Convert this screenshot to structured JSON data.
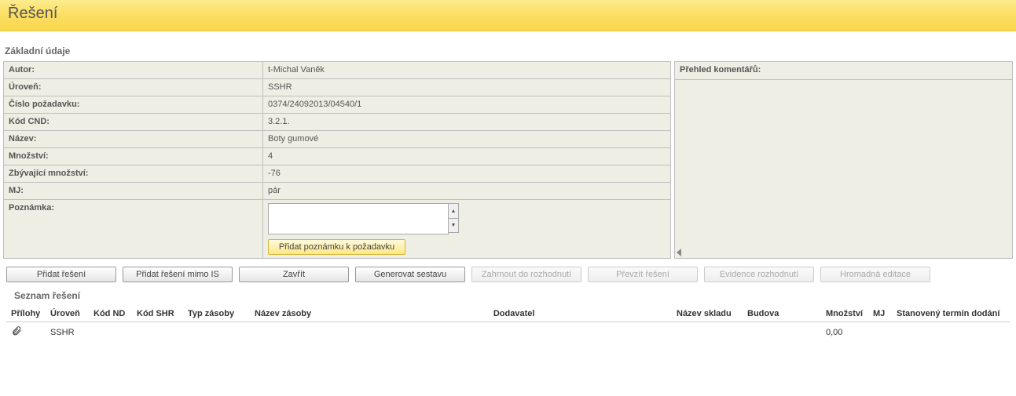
{
  "header": {
    "title": "Řešení"
  },
  "basic": {
    "section_title": "Základní údaje",
    "rows": {
      "author_label": "Autor:",
      "author_value": "t-Michal Vaněk",
      "level_label": "Úroveň:",
      "level_value": "SSHR",
      "reqnum_label": "Číslo požadavku:",
      "reqnum_value": "0374/24092013/04540/1",
      "cnd_label": "Kód CND:",
      "cnd_value": "3.2.1.",
      "name_label": "Název:",
      "name_value": "Boty gumové",
      "qty_label": "Množství:",
      "qty_value": "4",
      "remqty_label": "Zbývající množství:",
      "remqty_value": "-76",
      "mj_label": "MJ:",
      "mj_value": "pár",
      "note_label": "Poznámka:",
      "note_value": "",
      "add_note_btn": "Přidat poznámku k požadavku"
    }
  },
  "comments": {
    "title": "Přehled komentářů:"
  },
  "buttons": {
    "add_solution": "Přidat řešení",
    "add_solution_out": "Přidat řešení mimo IS",
    "close": "Zavřít",
    "generate": "Generovat sestavu",
    "include": "Zahrnout do rozhodnutí",
    "takeover": "Převzít řešení",
    "evidence": "Evidence rozhodnutí",
    "bulk": "Hromadná editace"
  },
  "solutions": {
    "title": "Seznam řešení",
    "headers": {
      "attachments": "Přílohy",
      "level": "Úroveň",
      "kod_nd": "Kód ND",
      "kod_shr": "Kód SHR",
      "typ_zasoby": "Typ zásoby",
      "nazev_zasoby": "Název zásoby",
      "dodavatel": "Dodavatel",
      "nazev_skladu": "Název skladu",
      "budova": "Budova",
      "mnozstvi": "Množství",
      "mj": "MJ",
      "termin": "Stanovený termín dodání"
    },
    "rows": [
      {
        "level": "SSHR",
        "mnozstvi": "0,00"
      }
    ]
  }
}
